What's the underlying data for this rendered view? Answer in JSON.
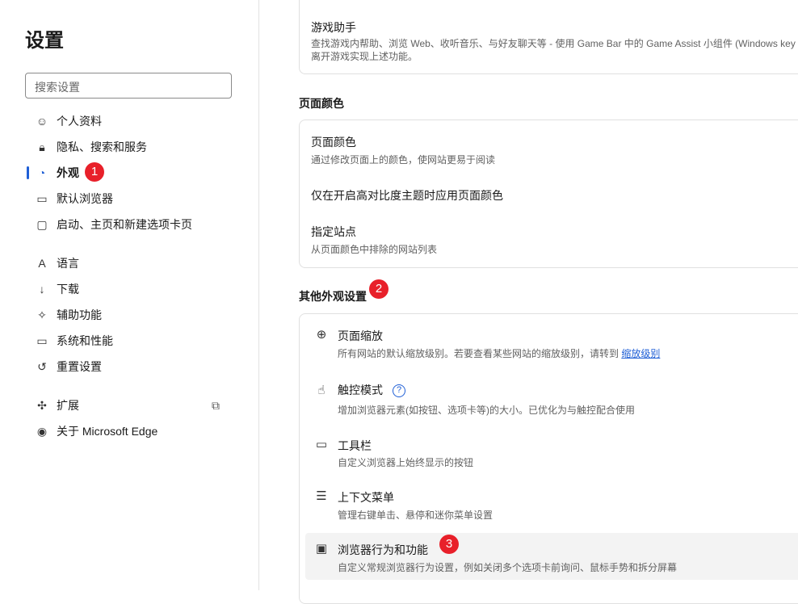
{
  "sidebar": {
    "title": "设置",
    "search_placeholder": "搜索设置",
    "items": [
      {
        "label": "个人资料",
        "icon": "profile-icon"
      },
      {
        "label": "隐私、搜索和服务",
        "icon": "lock-icon"
      },
      {
        "label": "外观",
        "icon": "palette-icon"
      },
      {
        "label": "默认浏览器",
        "icon": "browser-icon"
      },
      {
        "label": "启动、主页和新建选项卡页",
        "icon": "tab-icon"
      },
      {
        "label": "语言",
        "icon": "language-icon"
      },
      {
        "label": "下载",
        "icon": "download-icon"
      },
      {
        "label": "辅助功能",
        "icon": "accessibility-icon"
      },
      {
        "label": "系统和性能",
        "icon": "laptop-icon"
      },
      {
        "label": "重置设置",
        "icon": "reset-icon"
      },
      {
        "label": "扩展",
        "icon": "puzzle-icon"
      },
      {
        "label": "关于 Microsoft Edge",
        "icon": "edge-icon"
      }
    ]
  },
  "badges": [
    "1",
    "2",
    "3"
  ],
  "main": {
    "game": {
      "title": "游戏助手",
      "desc1": "查找游戏内帮助、浏览 Web、收听音乐、与好友聊天等 - 使用 Game Bar 中的 Game Assist 小组件 (Windows key + G)",
      "desc2": "离开游戏实现上述功能。"
    },
    "page_color_heading": "页面颜色",
    "page_color": {
      "title": "页面颜色",
      "desc": "通过修改页面上的颜色，使网站更易于阅读",
      "high_contrast": "仅在开启高对比度主题时应用页面颜色",
      "sites_title": "指定站点",
      "sites_desc": "从页面颜色中排除的网站列表"
    },
    "other_heading": "其他外观设置",
    "rows": [
      {
        "title": "页面缩放",
        "desc": "所有网站的默认缩放级别。若要查看某些网站的缩放级别，请转到 ",
        "link": "缩放级别"
      },
      {
        "title": "触控模式",
        "desc": "增加浏览器元素(如按钮、选项卡等)的大小。已优化为与触控配合使用",
        "help": "?"
      },
      {
        "title": "工具栏",
        "desc": "自定义浏览器上始终显示的按钮"
      },
      {
        "title": "上下文菜单",
        "desc": "管理右键单击、悬停和迷你菜单设置"
      },
      {
        "title": "浏览器行为和功能",
        "desc": "自定义常规浏览器行为设置，例如关闭多个选项卡前询问、鼠标手势和拆分屏幕"
      }
    ]
  }
}
